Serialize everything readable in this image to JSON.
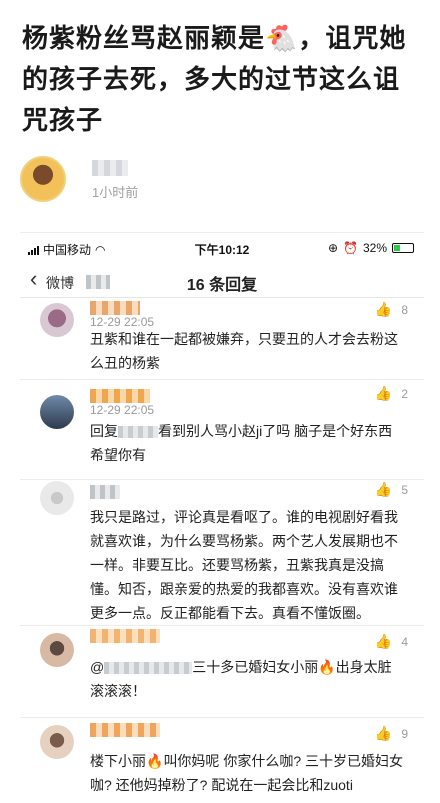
{
  "article": {
    "title": "杨紫粉丝骂赵丽颖是🐔，诅咒她的孩子去死，多大的过节这么诅咒孩子",
    "author_time": "1小时前"
  },
  "statusbar": {
    "carrier": "中国移动",
    "time": "下午10:12",
    "battery": "32%"
  },
  "navbar": {
    "back_label": "微博",
    "title": "16 条回复"
  },
  "replies": [
    {
      "time": "12-29 22:05",
      "likes": "8",
      "text": "丑紫和谁在一起都被嫌弃，只要丑的人才会去粉这么丑的杨紫"
    },
    {
      "time": "12-29 22:05",
      "likes": "2",
      "text_a": "回复",
      "text_b": "看到别人骂小赵ji了吗 脑子是个好东西 希望你有"
    },
    {
      "likes": "5",
      "text": "我只是路过，评论真是看呕了。谁的电视剧好看我就喜欢谁，为什么要骂杨紫。两个艺人发展期也不一样。非要互比。还要骂杨紫，丑紫我真是没搞懂。知否，跟亲爱的热爱的我都喜欢。没有喜欢谁更多一点。反正都能看下去。真看不懂饭圈。"
    },
    {
      "likes": "4",
      "text_a": "@",
      "text_b": "三十多已婚妇女小丽",
      "text_c": "出身太脏滚滚滚！"
    },
    {
      "likes": "9",
      "text": "楼下小丽",
      "text_b": "叫你妈呢 你家什么咖? 三十岁已婚妇女咖? 还他妈掉粉了? 配说在一起会比和zuoti"
    }
  ]
}
